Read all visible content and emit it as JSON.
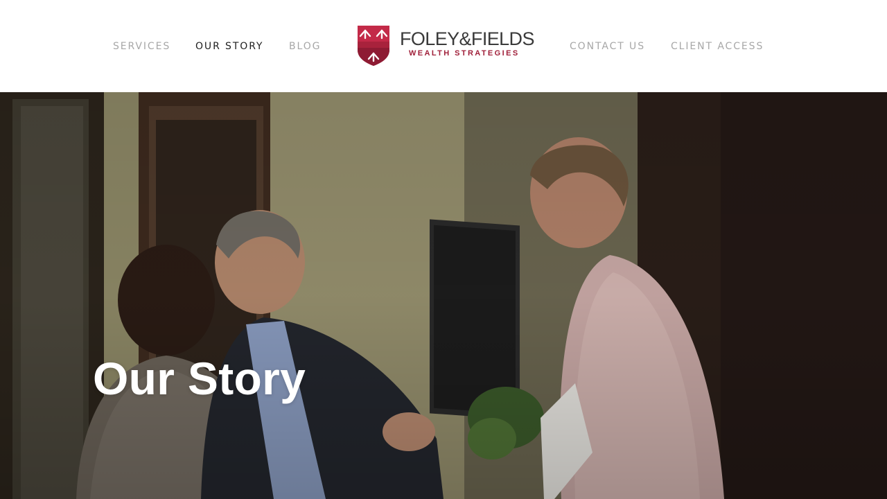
{
  "nav": {
    "left": [
      {
        "label": "SERVICES",
        "active": false
      },
      {
        "label": "OUR STORY",
        "active": true
      },
      {
        "label": "BLOG",
        "active": false
      }
    ],
    "right": [
      {
        "label": "CONTACT US",
        "active": false
      },
      {
        "label": "CLIENT ACCESS",
        "active": false
      }
    ]
  },
  "logo": {
    "name": "FOLEY&FIELDS",
    "tagline": "WEALTH STRATEGIES",
    "icon": "shield-logo-icon"
  },
  "hero": {
    "title": "Our Story",
    "image": "photo-of-three-people-talking-in-office-hallway"
  },
  "colors": {
    "brand_red": "#a0203a",
    "brand_dark": "#3a3a3a",
    "nav_inactive": "#a7a7a7",
    "nav_active": "#1e1e1e",
    "hero_text": "#ffffff"
  }
}
